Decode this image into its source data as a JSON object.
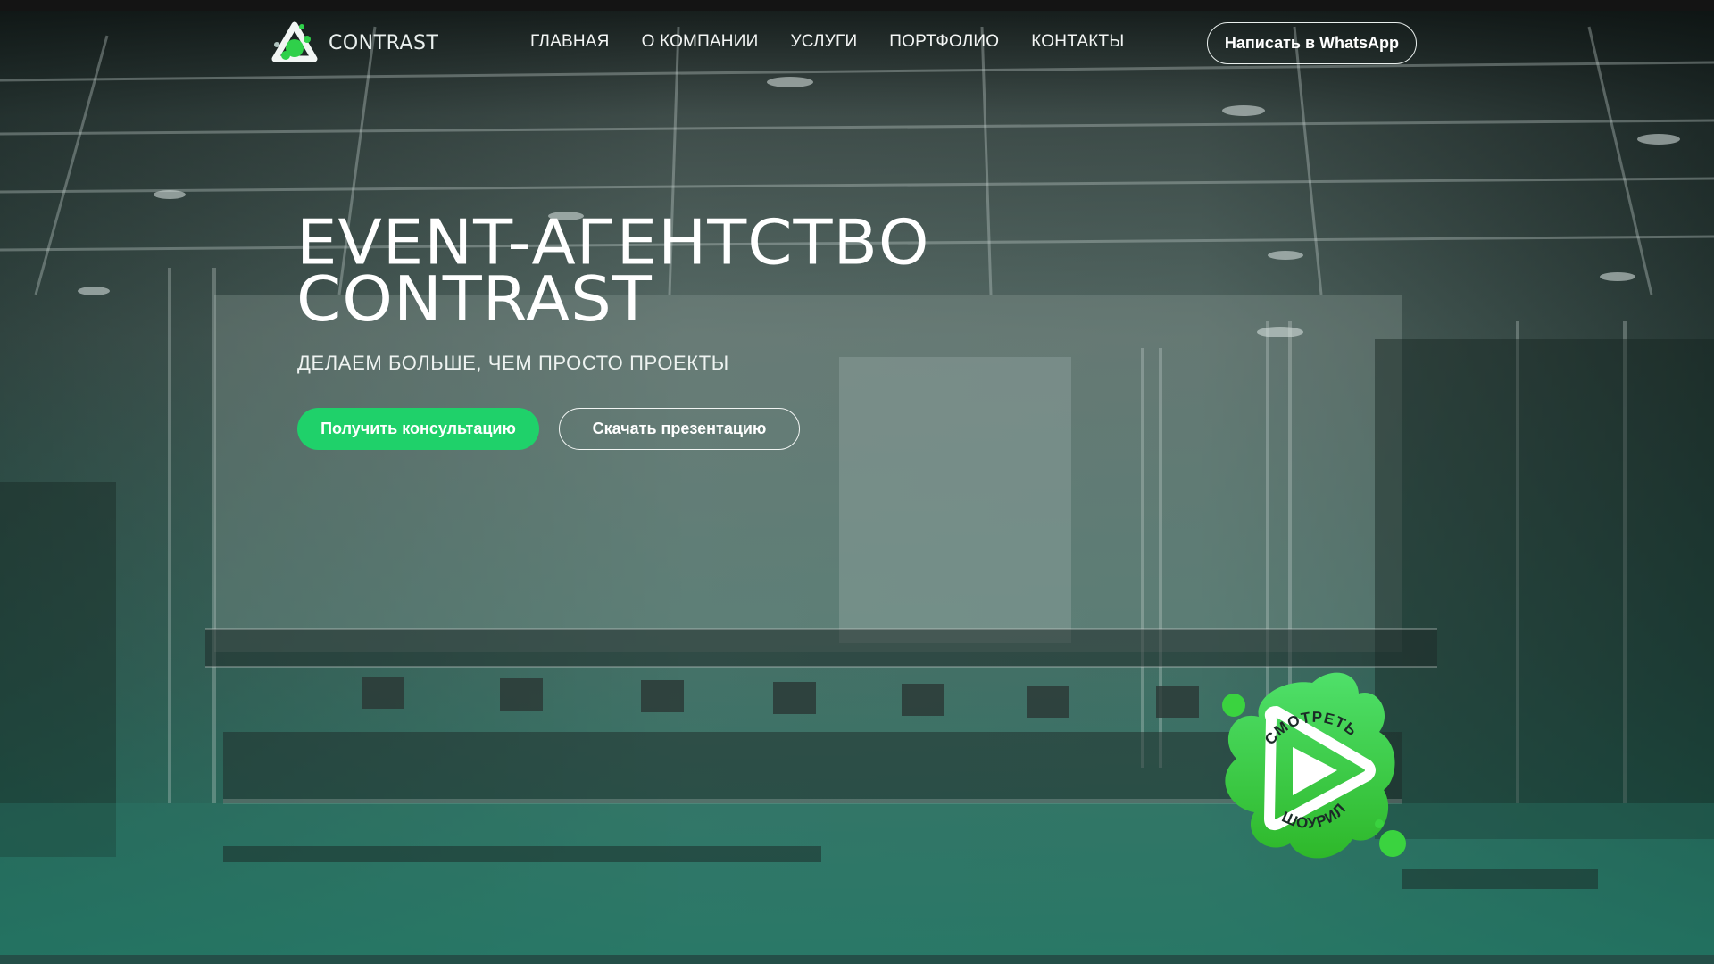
{
  "brand": {
    "name": "CONTRAST",
    "logo_icon": "contrast-logo-icon"
  },
  "nav": {
    "items": [
      {
        "label": "ГЛАВНАЯ"
      },
      {
        "label": "О КОМПАНИИ"
      },
      {
        "label": "УСЛУГИ"
      },
      {
        "label": "ПОРТФОЛИО"
      },
      {
        "label": "КОНТАКТЫ"
      }
    ],
    "whatsapp_label": "Написать в WhatsApp"
  },
  "hero": {
    "title_line1": "EVENT-АГЕНТСТВО",
    "title_line2": "CONTRAST",
    "subtitle": "ДЕЛАЕМ БОЛЬШЕ, ЧЕМ ПРОСТО ПРОЕКТЫ",
    "primary_button": "Получить консультацию",
    "secondary_button": "Скачать презентацию"
  },
  "showreel": {
    "label_top": "СМОТРЕТЬ",
    "label_bottom": "ШОУРИЛ",
    "icon": "play-icon"
  },
  "colors": {
    "accent_green": "#1fd16a",
    "splash_green": "#3ad33f",
    "tint_teal": "#2a7d6c"
  }
}
